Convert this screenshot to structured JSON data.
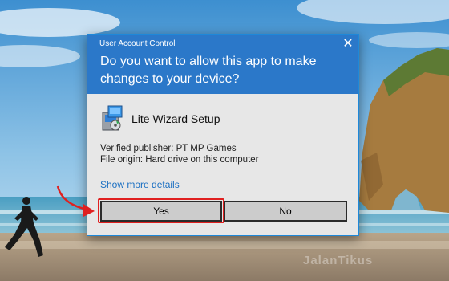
{
  "dialog": {
    "title": "User Account Control",
    "question": "Do you want to allow this app to make changes to your device?",
    "app_name": "Lite Wizard Setup",
    "publisher": "Verified publisher: PT MP Games",
    "origin": "File origin: Hard drive on this computer",
    "more_details": "Show more details",
    "yes_label": "Yes",
    "no_label": "No",
    "accent_color": "#2b78c9"
  },
  "annotation": {
    "highlight_color": "#e02020"
  },
  "watermark": {
    "text": "JalanTikus"
  }
}
